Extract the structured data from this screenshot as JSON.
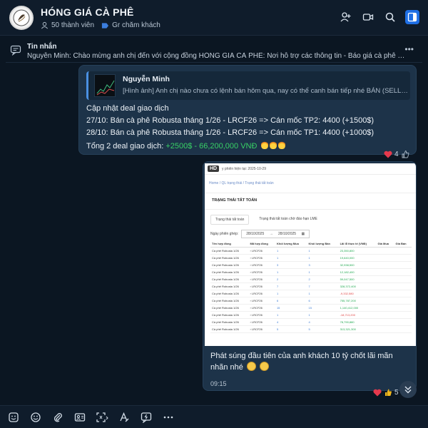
{
  "header": {
    "title": "HÓNG GIÁ CÀ PHÊ",
    "members": "50 thành viên",
    "community": "Gr chăm khách",
    "icons": [
      "add-member-icon",
      "video-call-icon",
      "search-icon",
      "sidebar-toggle-icon"
    ]
  },
  "pinned": {
    "title": "Tin nhắn",
    "text": "Nguyễn Minh: Chào mừng anh chị đến với cộng đồng HÓNG GIÁ CÀ PHÊ: Nơi hỗ trợ các thông tin  - Báo giá cà phê hằng ngày..."
  },
  "message1": {
    "quote_name": "Nguyễn Minh",
    "quote_text": "[Hình ảnh] Anh chị nào chưa có lệnh bán hôm qua, nay có thể canh bán tiếp nhé BÁN (SELL) CÀ PHÊ...",
    "line1": "Cập nhật deal giao dịch",
    "line2": "27/10: Bán cà phê Robusta tháng 1/26 - LRCF26 => Cán mốc TP2: 4400 (+1500$)",
    "line3": "28/10: Bán cà phê Robusta tháng 1/26 - LRCF26 => Cán mốc TP1: 4400 (+1000$)",
    "line4_prefix": "Tổng 2 deal giao dịch: ",
    "line4_green": "+2500$ - 66,200,000 VNĐ",
    "reaction_count": "4"
  },
  "message2": {
    "shot": {
      "session": "y phiên hiện tại: 2025-10-29",
      "breadcrumb": "Home  /  QL trạng thái  /  Trạng thái tất toán",
      "section_title": "TRẠNG THÁI TẤT TOÁN",
      "tab1": "Trạng thái tất toán",
      "tab2": "Trạng thái tất toán chờ đáo hạn LME",
      "filter_label": "Ngày phiên ghép:",
      "date_from": "28/10/2025",
      "date_to": "28/10/2025",
      "columns": [
        "Tên hợp đồng",
        "Mã hợp đồng",
        "Khối lượng Mua",
        "Khối lượng Bán",
        "Lãi lỗ thực tế (VNĐ)",
        "Giá Mua",
        "Giá Bán"
      ],
      "rows": [
        {
          "name": "Cà phê Robusta 1/26",
          "code": "LRCF26",
          "buy": "1",
          "sell": "1",
          "pl": "23,350,800",
          "dir": "pos"
        },
        {
          "name": "Cà phê Robusta 1/26",
          "code": "LRCF26",
          "buy": "1",
          "sell": "1",
          "pl": "19,640,000",
          "dir": "pos"
        },
        {
          "name": "Cà phê Robusta 1/26",
          "code": "LRCF26",
          "buy": "3",
          "sell": "3",
          "pl": "32,938,500",
          "dir": "pos"
        },
        {
          "name": "Cà phê Robusta 1/26",
          "code": "LRCF26",
          "buy": "1",
          "sell": "1",
          "pl": "12,182,400",
          "dir": "pos"
        },
        {
          "name": "Cà phê Robusta 1/26",
          "code": "LRCF26",
          "buy": "2",
          "sell": "2",
          "pl": "59,047,500",
          "dir": "pos"
        },
        {
          "name": "Cà phê Robusta 1/26",
          "code": "LRCF26",
          "buy": "7",
          "sell": "7",
          "pl": "328,372,400",
          "dir": "pos"
        },
        {
          "name": "Cà phê Robusta 1/26",
          "code": "LRCF26",
          "buy": "1",
          "sell": "1",
          "pl": "-9,332,580",
          "dir": "neg"
        },
        {
          "name": "Cà phê Robusta 1/26",
          "code": "LRCF26",
          "buy": "6",
          "sell": "6",
          "pl": "755,787,200",
          "dir": "pos"
        },
        {
          "name": "Cà phê Robusta 1/26",
          "code": "LRCF26",
          "buy": "15",
          "sell": "15",
          "pl": "1,140,412,000",
          "dir": "pos"
        },
        {
          "name": "Cà phê Robusta 1/26",
          "code": "LRCF26",
          "buy": "1",
          "sell": "1",
          "pl": "-18,713,200",
          "dir": "neg"
        },
        {
          "name": "Cà phê Robusta 1/26",
          "code": "LRCF26",
          "buy": "4",
          "sell": "4",
          "pl": "78,790,880",
          "dir": "pos"
        },
        {
          "name": "Cà phê Robusta 1/26",
          "code": "LRCF26",
          "buy": "5",
          "sell": "5",
          "pl": "313,321,300",
          "dir": "pos"
        }
      ]
    },
    "text": "Phát súng đầu tiên của anh khách 10 tỷ chốt lãi mãn nhãn nhé",
    "time": "09:15",
    "reaction_count": "5"
  },
  "toolbar": {
    "icons": [
      "sticker-icon",
      "emoji-icon",
      "attach-icon",
      "contact-card-icon",
      "screenshot-icon",
      "format-text-icon",
      "quick-message-icon",
      "more-icon"
    ]
  },
  "colors": {
    "background": "#0b1622",
    "bubble": "#1d3349",
    "accent": "#1f6fe5",
    "profit_green": "#38d066"
  }
}
